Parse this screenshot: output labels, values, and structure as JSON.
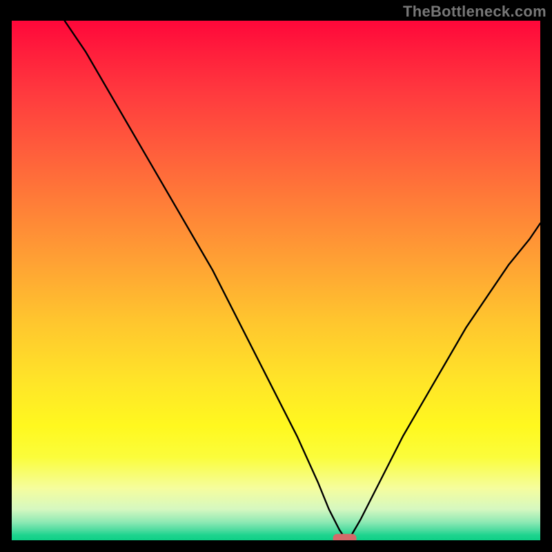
{
  "watermark": "TheBottleneck.com",
  "chart_data": {
    "type": "line",
    "title": "",
    "xlabel": "",
    "ylabel": "",
    "xlim": [
      0,
      100
    ],
    "ylim": [
      0,
      100
    ],
    "background": "red-yellow-green vertical gradient",
    "series": [
      {
        "name": "bottleneck-curve",
        "x": [
          10,
          14,
          18,
          22,
          26,
          30,
          34,
          38,
          42,
          46,
          50,
          54,
          58,
          60,
          62,
          63,
          64,
          66,
          70,
          74,
          78,
          82,
          86,
          90,
          94,
          98,
          100
        ],
        "y": [
          100,
          94,
          87,
          80,
          73,
          66,
          59,
          52,
          44,
          36,
          28,
          20,
          11,
          6,
          2,
          0.5,
          0.5,
          4,
          12,
          20,
          27,
          34,
          41,
          47,
          53,
          58,
          61
        ]
      }
    ],
    "marker": {
      "name": "optimal-point",
      "x": 63,
      "y": 0.3,
      "color": "#d46a6a",
      "shape": "rounded-rect"
    },
    "grid": false,
    "legend": false
  }
}
